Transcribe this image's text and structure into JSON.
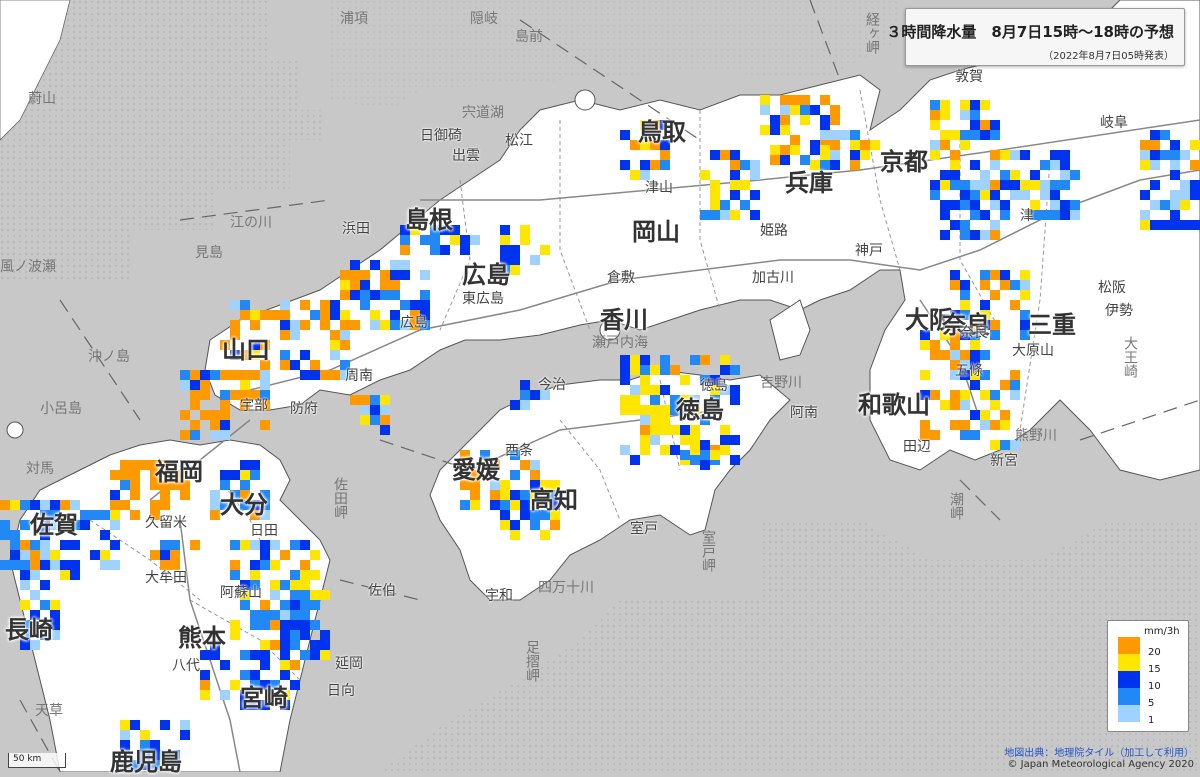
{
  "title": {
    "main": "３時間降水量　8月7日15時〜18時の予想",
    "sub": "（2022年8月7日05時発表）"
  },
  "legend": {
    "unit": "mm/3h",
    "levels": [
      {
        "label": "20",
        "color": "#ff9900"
      },
      {
        "label": "15",
        "color": "#ffe600"
      },
      {
        "label": "10",
        "color": "#0033ee"
      },
      {
        "label": "5",
        "color": "#2288f5"
      },
      {
        "label": "1",
        "color": "#a0d2ff"
      }
    ]
  },
  "scale_label": "50 km",
  "credit": "地図出典：地理院タイル（加工して利用）",
  "copyright": "© Japan Meteorological Agency 2020",
  "colors": {
    "sea": "#c8c8c8",
    "land": "#ffffff",
    "heavy": "#ff9900",
    "strong": "#ffe600",
    "moderate": "#0033ee",
    "light": "#2288f5",
    "weak": "#a0d2ff"
  },
  "places": {
    "prefectures": [
      "島根",
      "広島",
      "山口",
      "鳥取",
      "岡山",
      "兵庫",
      "京都",
      "大阪",
      "奈良",
      "三重",
      "和歌山",
      "徳島",
      "香川",
      "愛媛",
      "高知",
      "福岡",
      "佐賀",
      "大分",
      "熊本",
      "宮崎",
      "鹿児島",
      "長崎"
    ],
    "cities": [
      "浜田",
      "松江",
      "出雲",
      "津山",
      "倉敷",
      "姫路",
      "神戸",
      "加古川",
      "東広島",
      "広島",
      "周南",
      "防府",
      "今治",
      "西条",
      "徳島",
      "阿南",
      "田辺",
      "新宮",
      "室戸",
      "宇和",
      "佐伯",
      "延岡",
      "日向",
      "八代",
      "大牟田",
      "久留米",
      "日田",
      "阿蘇山",
      "敦賀",
      "岐阜",
      "津",
      "松阪",
      "伊勢",
      "奈良",
      "五條",
      "日御碕",
      "宇部",
      "大原山"
    ],
    "sea_names": [
      "隠岐",
      "島前",
      "宍道湖",
      "見島",
      "風ノ波瀬",
      "沖ノ島",
      "小呂島",
      "江の川",
      "佐田岬",
      "足摺岬",
      "室戸岬",
      "潮岬",
      "熊野川",
      "吉野川",
      "四万十川",
      "経ヶ岬",
      "大王崎",
      "瀬戸内海",
      "蔚山",
      "浦項",
      "対馬",
      "天草"
    ]
  }
}
